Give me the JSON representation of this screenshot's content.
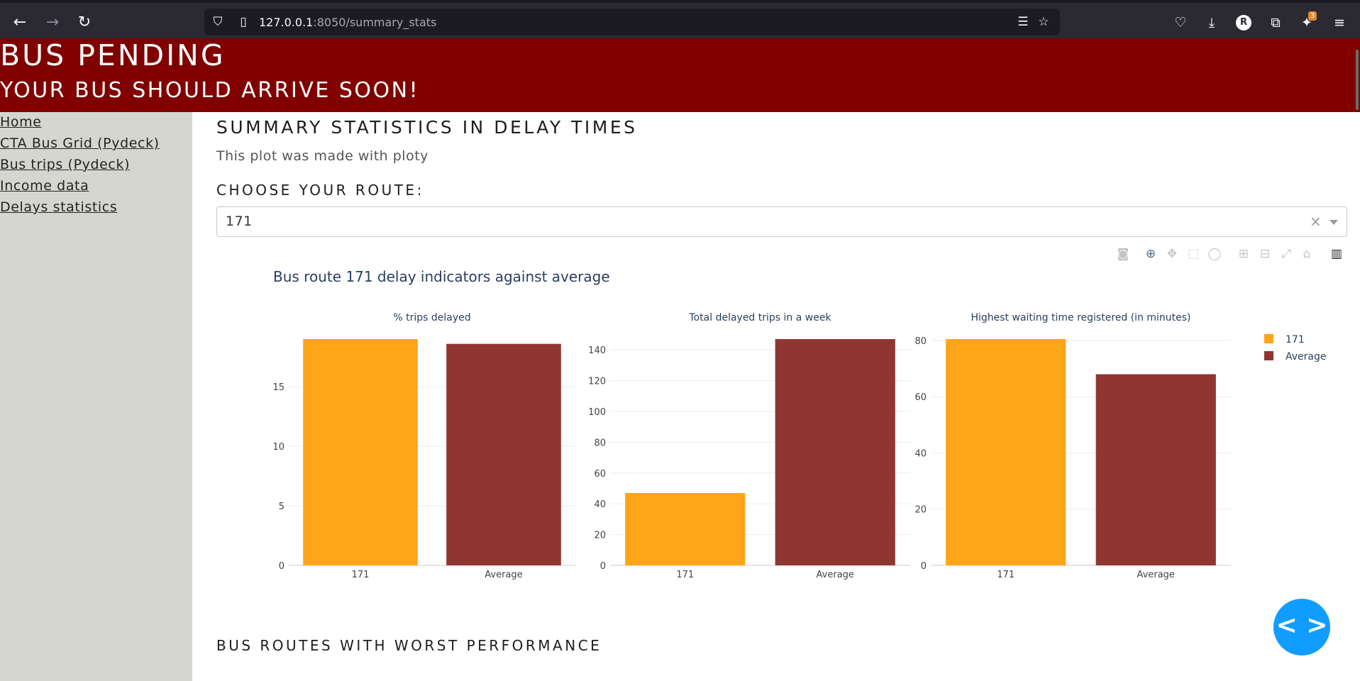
{
  "browser": {
    "url_host": "127.0.0.1",
    "url_port_path": ":8050/summary_stats",
    "extension_badge": "3",
    "profile_initial": "R",
    "icons": [
      "back-arrow-icon",
      "forward-arrow-icon",
      "reload-icon",
      "shield-icon",
      "page-icon",
      "reader-view-icon",
      "bookmark-star-icon",
      "pocket-icon",
      "download-icon",
      "extensions-icon",
      "extension-icon",
      "menu-icon"
    ]
  },
  "header": {
    "title": "BUS PENDING",
    "subtitle": "YOUR BUS SHOULD ARRIVE SOON!",
    "background_color": "#800000"
  },
  "sidebar": {
    "items": [
      {
        "label": "Home"
      },
      {
        "label": "CTA Bus Grid (Pydeck)"
      },
      {
        "label": "Bus trips (Pydeck)"
      },
      {
        "label": "Income data"
      },
      {
        "label": "Delays statistics"
      }
    ]
  },
  "main": {
    "section_title": "SUMMARY STATISTICS IN DELAY TIMES",
    "plot_note": "This plot was made with ploty",
    "route_label": "CHOOSE YOUR ROUTE:",
    "route_value": "171",
    "clear_symbol": "×",
    "next_section_title": "BUS ROUTES WITH WORST PERFORMANCE",
    "fab_label": "< >"
  },
  "modebar_icons": [
    "camera-icon",
    "zoom-icon",
    "pan-icon",
    "box-select-icon",
    "lasso-icon",
    "zoom-in-icon",
    "zoom-out-icon",
    "autoscale-icon",
    "reset-axes-icon",
    "plotly-logo-icon"
  ],
  "chart_data": {
    "type": "bar",
    "title": "Bus route 171 delay indicators against average",
    "categories": [
      "171",
      "Average"
    ],
    "colors": {
      "171": "#ffa51a",
      "Average": "#903630"
    },
    "legend": {
      "position": "top-right",
      "entries": [
        "171",
        "Average"
      ]
    },
    "grid": true,
    "subplots": [
      {
        "title": "% trips delayed",
        "values": [
          19,
          18.6
        ],
        "ylim": [
          0,
          19
        ],
        "yticks": [
          0,
          5,
          10,
          15
        ]
      },
      {
        "title": "Total delayed trips in a week",
        "values": [
          47,
          147
        ],
        "ylim": [
          0,
          147
        ],
        "yticks": [
          0,
          20,
          40,
          60,
          80,
          100,
          120,
          140
        ]
      },
      {
        "title": "Highest waiting time registered (in minutes)",
        "values": [
          80.5,
          68
        ],
        "ylim": [
          0,
          80.5
        ],
        "yticks": [
          0,
          20,
          40,
          60,
          80
        ]
      }
    ]
  }
}
